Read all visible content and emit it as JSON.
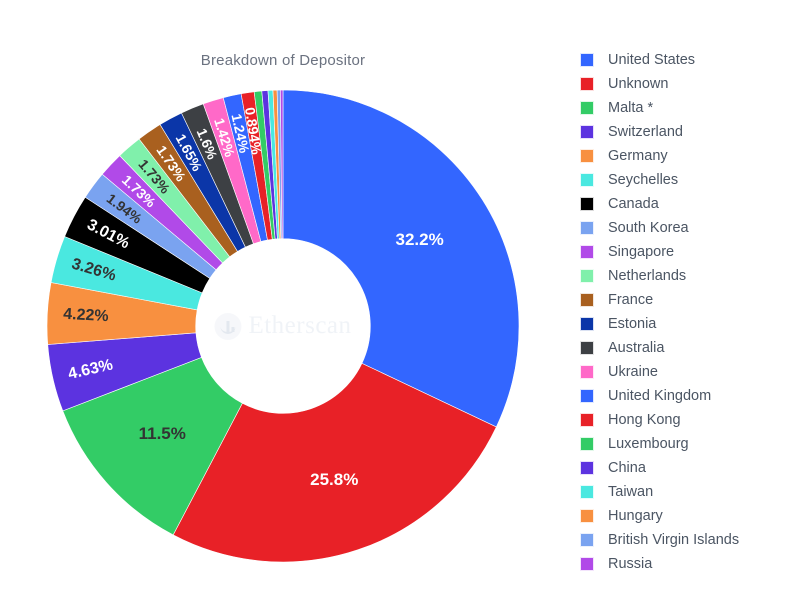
{
  "watermark": {
    "text": "Etherscan",
    "logo_icon": "bar-chart-circle-icon"
  },
  "chart_data": {
    "type": "pie",
    "variant": "donut",
    "title": "Breakdown of Depositor",
    "xlabel": "",
    "ylabel": "",
    "legend_position": "right",
    "grid": false,
    "start_angle_deg": 0,
    "direction": "clockwise",
    "inner_radius_ratio": 0.37,
    "value_unit": "percent",
    "labels": [
      "United States",
      "Unknown",
      "Malta *",
      "Switzerland",
      "Germany",
      "Seychelles",
      "Canada",
      "South Korea",
      "Singapore",
      "Netherlands",
      "France",
      "Estonia",
      "Australia",
      "Ukraine",
      "United Kingdom",
      "Hong Kong",
      "Luxembourg",
      "China",
      "Taiwan",
      "Hungary",
      "British Virgin Islands",
      "Russia"
    ],
    "values": [
      32.2,
      25.8,
      11.5,
      4.63,
      4.22,
      3.26,
      3.01,
      1.94,
      1.73,
      1.73,
      1.73,
      1.65,
      1.6,
      1.42,
      1.24,
      0.894,
      0.52,
      0.42,
      0.34,
      0.28,
      0.22,
      0.18
    ],
    "data_labels": [
      "32.2%",
      "25.8%",
      "11.5%",
      "4.63%",
      "4.22%",
      "3.26%",
      "3.01%",
      "1.94%",
      "1.73%",
      "1.73%",
      "1.73%",
      "1.65%",
      "1.6%",
      "1.42%",
      "1.24%",
      "0.894%",
      "",
      "",
      "",
      "",
      "",
      ""
    ],
    "colors": [
      "#3366ff",
      "#e82127",
      "#33cc66",
      "#5c33e0",
      "#f89040",
      "#4ae8e0",
      "#000000",
      "#7aa3f0",
      "#b14ae8",
      "#80f0ab",
      "#a9601f",
      "#0b36a8",
      "#3d4044",
      "#ff69c8",
      "#3366ff",
      "#e82127",
      "#33cc66",
      "#5c33e0",
      "#4ae8e0",
      "#f89040",
      "#7aa3f0",
      "#b14ae8"
    ],
    "label_text_colors": [
      "#ffffff",
      "#ffffff",
      "#333333",
      "#ffffff",
      "#333333",
      "#333333",
      "#ffffff",
      "#333333",
      "#ffffff",
      "#333333",
      "#ffffff",
      "#ffffff",
      "#ffffff",
      "#ffffff",
      "#ffffff",
      "#ffffff",
      "",
      "",
      "",
      "",
      "",
      ""
    ]
  },
  "legend": {
    "items": [
      {
        "label": "United States",
        "color": "#3366ff"
      },
      {
        "label": "Unknown",
        "color": "#e82127"
      },
      {
        "label": "Malta *",
        "color": "#33cc66"
      },
      {
        "label": "Switzerland",
        "color": "#5c33e0"
      },
      {
        "label": "Germany",
        "color": "#f89040"
      },
      {
        "label": "Seychelles",
        "color": "#4ae8e0"
      },
      {
        "label": "Canada",
        "color": "#000000"
      },
      {
        "label": "South Korea",
        "color": "#7aa3f0"
      },
      {
        "label": "Singapore",
        "color": "#b14ae8"
      },
      {
        "label": "Netherlands",
        "color": "#80f0ab"
      },
      {
        "label": "France",
        "color": "#a9601f"
      },
      {
        "label": "Estonia",
        "color": "#0b36a8"
      },
      {
        "label": "Australia",
        "color": "#3d4044"
      },
      {
        "label": "Ukraine",
        "color": "#ff69c8"
      },
      {
        "label": "United Kingdom",
        "color": "#3366ff"
      },
      {
        "label": "Hong Kong",
        "color": "#e82127"
      },
      {
        "label": "Luxembourg",
        "color": "#33cc66"
      },
      {
        "label": "China",
        "color": "#5c33e0"
      },
      {
        "label": "Taiwan",
        "color": "#4ae8e0"
      },
      {
        "label": "Hungary",
        "color": "#f89040"
      },
      {
        "label": "British Virgin Islands",
        "color": "#7aa3f0"
      },
      {
        "label": "Russia",
        "color": "#b14ae8"
      }
    ]
  }
}
